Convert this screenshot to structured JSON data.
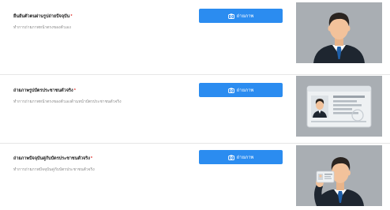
{
  "rows": [
    {
      "title": "ยืนยันตัวตนผ่านรูปถ่ายปัจจุบัน",
      "required_mark": "*",
      "description": "ทำการถ่ายภาพหน้าตรงของตัวเอง",
      "button_label": "ถ่ายภาพ",
      "button_icon": "camera-icon",
      "example_image": "person-portrait"
    },
    {
      "title": "ถ่ายภาพรูปบัตรประชาชนตัวจริง",
      "required_mark": "*",
      "description": "ทำการถ่ายภาพหน้าตรงของตัวเองด้านหน้าบัตรประชาชนตัวจริง",
      "button_label": "ถ่ายภาพ",
      "button_icon": "camera-icon",
      "example_image": "id-card"
    },
    {
      "title": "ถ่ายภาพปัจจุบันคู่กับบัตรประชาชนตัวจริง",
      "required_mark": "*",
      "description": "ทำการถ่ายภาพปัจจุบันคู่กับบัตรประชาชนตัวจริง",
      "button_label": "ถ่ายภาพ",
      "button_icon": "camera-icon",
      "example_image": "person-holding-id-card"
    }
  ],
  "colors": {
    "button": "#2b8cf0",
    "required": "#e0312d",
    "thumb_bg": "#a9aeb3",
    "suit": "#1e2630",
    "tie": "#1f5fa8",
    "skin": "#f2c29b",
    "hair": "#2a2420"
  }
}
